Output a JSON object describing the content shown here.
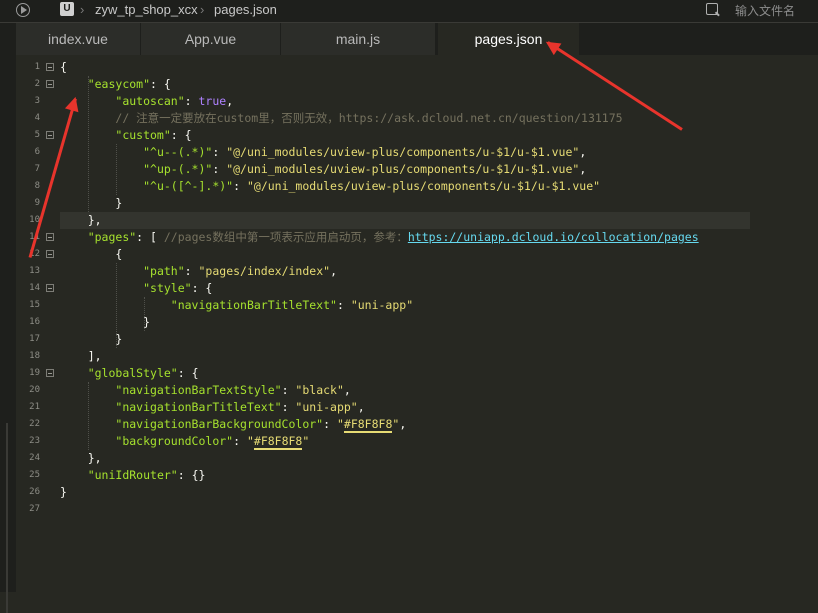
{
  "topbar": {
    "project_icon": "U",
    "project_name": "zyw_tp_shop_xcx",
    "file_name": "pages.json",
    "search_placeholder": "输入文件名"
  },
  "tabs": [
    {
      "label": "index.vue",
      "active": false
    },
    {
      "label": "App.vue",
      "active": false
    },
    {
      "label": "main.js",
      "active": false
    },
    {
      "label": "pages.json",
      "active": true
    }
  ],
  "line_numbers": [
    "1",
    "2",
    "3",
    "4",
    "5",
    "6",
    "7",
    "8",
    "9",
    "10",
    "11",
    "12",
    "13",
    "14",
    "15",
    "16",
    "17",
    "18",
    "19",
    "20",
    "21",
    "22",
    "23",
    "24",
    "25",
    "26",
    "27"
  ],
  "code": {
    "l1": "{",
    "l2_key": "\"easycom\"",
    "l2_rest": ": {",
    "l3_key": "\"autoscan\"",
    "l3_colon": ": ",
    "l3_val": "true",
    "l3_comma": ",",
    "l4_comment": "// 注意一定要放在custom里，否则无效，https://ask.dcloud.net.cn/question/131175",
    "l5_key": "\"custom\"",
    "l5_rest": ": {",
    "l6_key": "\"^u--(.*)\"",
    "l6_colon": ": ",
    "l6_val": "\"@/uni_modules/uview-plus/components/u-$1/u-$1.vue\"",
    "l6_comma": ",",
    "l7_key": "\"^up-(.*)\"",
    "l7_colon": ": ",
    "l7_val": "\"@/uni_modules/uview-plus/components/u-$1/u-$1.vue\"",
    "l7_comma": ",",
    "l8_key": "\"^u-([^-].*)\"",
    "l8_colon": ": ",
    "l8_val": "\"@/uni_modules/uview-plus/components/u-$1/u-$1.vue\"",
    "l9": "}",
    "l10": "},",
    "l11_key": "\"pages\"",
    "l11_rest": ": [ ",
    "l11_comment": "//pages数组中第一项表示应用启动页，参考：",
    "l11_link": "https://uniapp.dcloud.io/collocation/pages",
    "l12": "{",
    "l13_key": "\"path\"",
    "l13_colon": ": ",
    "l13_val": "\"pages/index/index\"",
    "l13_comma": ",",
    "l14_key": "\"style\"",
    "l14_rest": ": {",
    "l15_key": "\"navigationBarTitleText\"",
    "l15_colon": ": ",
    "l15_val": "\"uni-app\"",
    "l16": "}",
    "l17": "}",
    "l18": "],",
    "l19_key": "\"globalStyle\"",
    "l19_rest": ": {",
    "l20_key": "\"navigationBarTextStyle\"",
    "l20_colon": ": ",
    "l20_val": "\"black\"",
    "l20_comma": ",",
    "l21_key": "\"navigationBarTitleText\"",
    "l21_colon": ": ",
    "l21_val": "\"uni-app\"",
    "l21_comma": ",",
    "l22_key": "\"navigationBarBackgroundColor\"",
    "l22_colon": ": ",
    "l22_q1": "\"",
    "l22_color": "#F8F8F8",
    "l22_q2": "\"",
    "l22_comma": ",",
    "l23_key": "\"backgroundColor\"",
    "l23_colon": ": ",
    "l23_q1": "\"",
    "l23_color": "#F8F8F8",
    "l23_q2": "\"",
    "l24": "},",
    "l25_key": "\"uniIdRouter\"",
    "l25_rest": ": {}",
    "l26": "}"
  },
  "colors": {
    "keyword": "#a6e22e",
    "string": "#e6db74",
    "boolean": "#ae81ff",
    "comment": "#75715e",
    "annotation_arrow": "#e8342c"
  }
}
